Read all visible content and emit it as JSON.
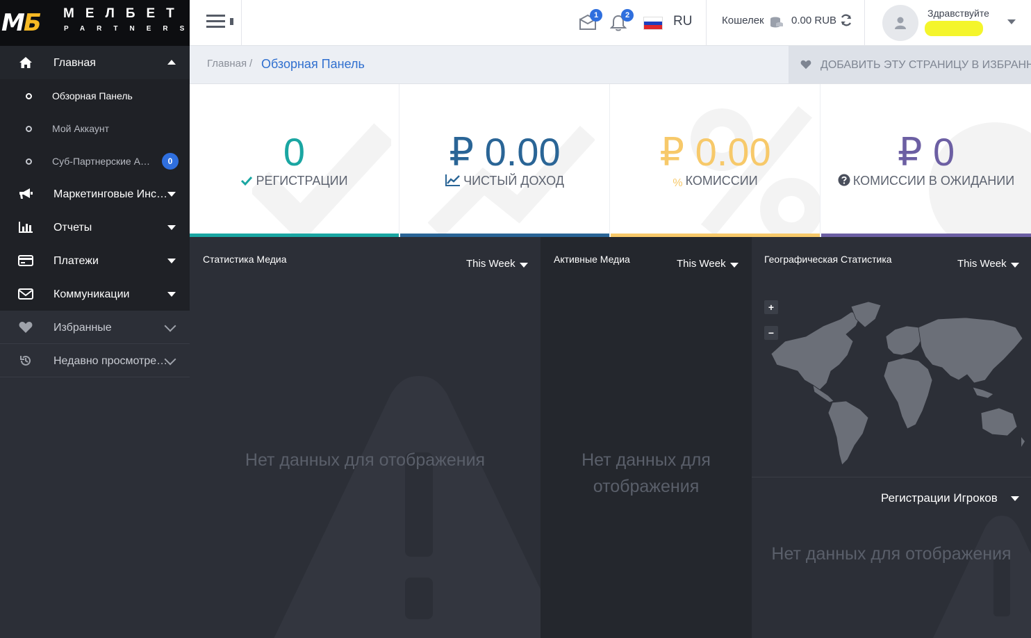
{
  "brand": {
    "mark_m": "М",
    "mark_b": "Б",
    "name": "МЕЛБЕТ",
    "sub": "PARTNERS"
  },
  "sidebar": {
    "main": {
      "label": "Главная",
      "icon": "home-icon"
    },
    "sub_items": [
      {
        "label": "Обзорная Панель",
        "current": true
      },
      {
        "label": "Мой Аккаунт"
      },
      {
        "label": "Суб-Партнерские Аккаунты",
        "badge": "0"
      }
    ],
    "items": [
      {
        "label": "Маркетинговые Инструменты",
        "icon": "bullhorn-icon"
      },
      {
        "label": "Отчеты",
        "icon": "bar-chart-icon"
      },
      {
        "label": "Платежи",
        "icon": "credit-card-icon"
      },
      {
        "label": "Коммуникации",
        "icon": "envelope-icon"
      }
    ],
    "favorites": {
      "label": "Избранные",
      "icon": "heart-icon"
    },
    "recent": {
      "label": "Недавно просмотренные",
      "icon": "history-icon"
    }
  },
  "topbar": {
    "messages_count": "1",
    "notifications_count": "2",
    "language": "RU",
    "wallet_label": "Кошелек",
    "wallet_value": "0.00 RUB",
    "greeting": "Здравствуйте"
  },
  "breadcrumb": {
    "home": "Главная",
    "separator": "/",
    "current": "Обзорная Панель",
    "favorite_button": "ДОБАВИТЬ ЭТУ СТРАНИЦУ В ИЗБРАННОЕ"
  },
  "stats": [
    {
      "value": "0",
      "label": "РЕГИСТРАЦИИ",
      "color": "#1aa6a2",
      "icon": "check-icon"
    },
    {
      "value": "₽ 0.00",
      "label": "ЧИСТЫЙ ДОХОД",
      "color": "#2a6596",
      "icon": "line-chart-icon"
    },
    {
      "value": "₽ 0.00",
      "label": "КОМИССИИ",
      "color": "#f7c96a",
      "icon": "percent-icon",
      "icon_text": "%"
    },
    {
      "value": "₽ 0",
      "label": "КОМИССИИ В ОЖИДАНИИ",
      "color": "#6c5fa3",
      "icon": "question-circle-icon"
    }
  ],
  "widgets": {
    "media_stats": {
      "title": "Статистика Медиа",
      "period": "This Week",
      "empty": "Нет данных для отображения"
    },
    "active_media": {
      "title": "Активные Медиа",
      "period": "This Week",
      "empty": "Нет данных для отображения"
    },
    "geo_stats": {
      "title": "Географическая Статистика",
      "period": "This Week",
      "zoom_in": "+",
      "zoom_out": "−"
    },
    "player_regs": {
      "title": "Регистрации Игроков",
      "empty": "Нет данных для отображения"
    }
  }
}
